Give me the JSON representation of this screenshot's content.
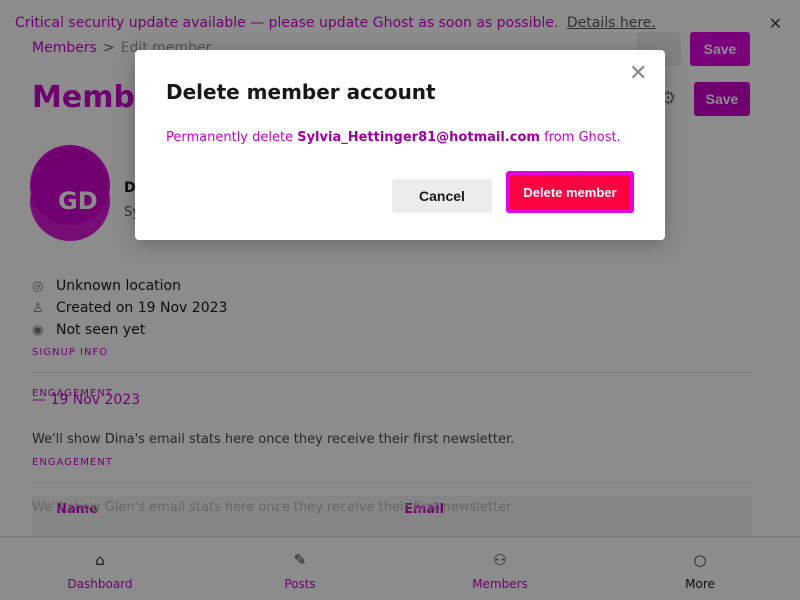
{
  "banner": {
    "text": "Critical security update available — please update Ghost as soon as possible.",
    "link": "Details here.",
    "close": "✕"
  },
  "breadcrumb": {
    "root": "Members",
    "sep": ">",
    "current": "Edit member"
  },
  "header": {
    "title": "Member",
    "save_label": "Save",
    "top_save_label": "Save"
  },
  "profile": {
    "initials": "GD",
    "name": "Dina",
    "email": "Sylvia"
  },
  "meta": {
    "location": "Unknown location",
    "created": "Created on 19 Nov 2023",
    "seen": "Not seen yet",
    "signup_label": "Signup info"
  },
  "engagement": {
    "label": "Engagement",
    "created_line": "— 19 Nov 2023",
    "text": "We'll show Dina's email stats here once they receive their first newsletter.",
    "label2": "Engagement",
    "ghost_text": "We'll show Glen's email stats here once they receive their first newsletter."
  },
  "table": {
    "col_name": "Name",
    "col_email": "Email"
  },
  "nav": [
    {
      "label": "Dashboard",
      "icon": "home-icon"
    },
    {
      "label": "Posts",
      "icon": "posts-icon"
    },
    {
      "label": "Members",
      "icon": "members-icon"
    },
    {
      "label": "More",
      "icon": "more-icon"
    }
  ],
  "modal": {
    "title": "Delete member account",
    "body_prefix": "Permanently delete ",
    "body_email": "Sylvia_Hettinger81@hotmail.com",
    "body_suffix": " from Ghost.",
    "cancel_label": "Cancel",
    "delete_label": "Delete member"
  }
}
